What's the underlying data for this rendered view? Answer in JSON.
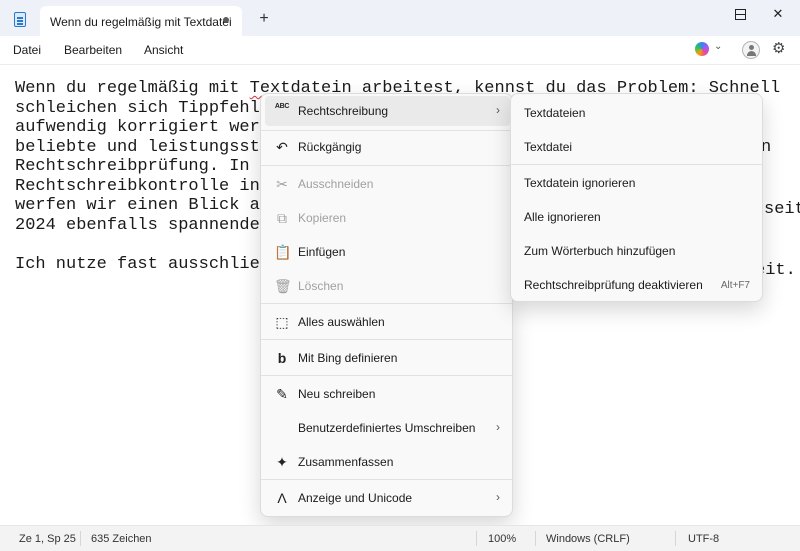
{
  "tab": {
    "title": "Wenn du regelmäßig mit Textdatei",
    "new_tab": "+"
  },
  "window": {
    "close": "✕"
  },
  "menubar": {
    "file": "Datei",
    "edit": "Bearbeiten",
    "view": "Ansicht"
  },
  "editor": {
    "lines": [
      "Wenn du regelmäßig mit ",
      "Textdatein",
      " arbeitest, kennst du das Problem: Schnell",
      "schleichen sich Tippfehler",
      "aufwendig korrigiert werd",
      "beliebte und leistungssta",
      "Rechtschreibprüfung. In d",
      "Rechtschreibkontrolle in",
      "werfen wir einen Blick au",
      "2024 ebenfalls spannende",
      "Ich nutze fast ausschlie"
    ],
    "right_fragments": {
      "line4": "n",
      "line8": "seit",
      "line10": "eit."
    }
  },
  "context_menu": {
    "items": [
      {
        "icon": "ABC",
        "label": "Rechtschreibung",
        "submenu": true
      },
      {
        "icon": "↶",
        "label": "Rückgängig"
      },
      {
        "icon": "✂",
        "label": "Ausschneiden",
        "disabled": true
      },
      {
        "icon": "⧉",
        "label": "Kopieren",
        "disabled": true
      },
      {
        "icon": "📋",
        "label": "Einfügen"
      },
      {
        "icon": "🗑",
        "label": "Löschen",
        "disabled": true
      },
      {
        "icon": "⬚",
        "label": "Alles auswählen"
      },
      {
        "icon": "b",
        "label": "Mit Bing definieren"
      },
      {
        "icon": "✎",
        "label": "Neu schreiben"
      },
      {
        "icon": "",
        "label": "Benutzerdefiniertes Umschreiben",
        "submenu": true
      },
      {
        "icon": "✦",
        "label": "Zusammenfassen"
      },
      {
        "icon": "Λ",
        "label": "Anzeige und Unicode",
        "submenu": true
      }
    ],
    "chevron": "›"
  },
  "submenu": {
    "items": [
      {
        "label": "Textdateien"
      },
      {
        "label": "Textdatei"
      },
      {
        "label": "Textdatein ignorieren"
      },
      {
        "label": "Alle ignorieren"
      },
      {
        "label": "Zum Wörterbuch hinzufügen"
      },
      {
        "label": "Rechtschreibprüfung deaktivieren",
        "shortcut": "Alt+F7"
      }
    ]
  },
  "statusbar": {
    "position": "Ze 1, Sp 25",
    "chars": "635 Zeichen",
    "zoom": "100%",
    "line_ending": "Windows (CRLF)",
    "encoding": "UTF-8"
  },
  "colors": {
    "accent": "#2b79c8",
    "squiggle": "#d13438"
  }
}
